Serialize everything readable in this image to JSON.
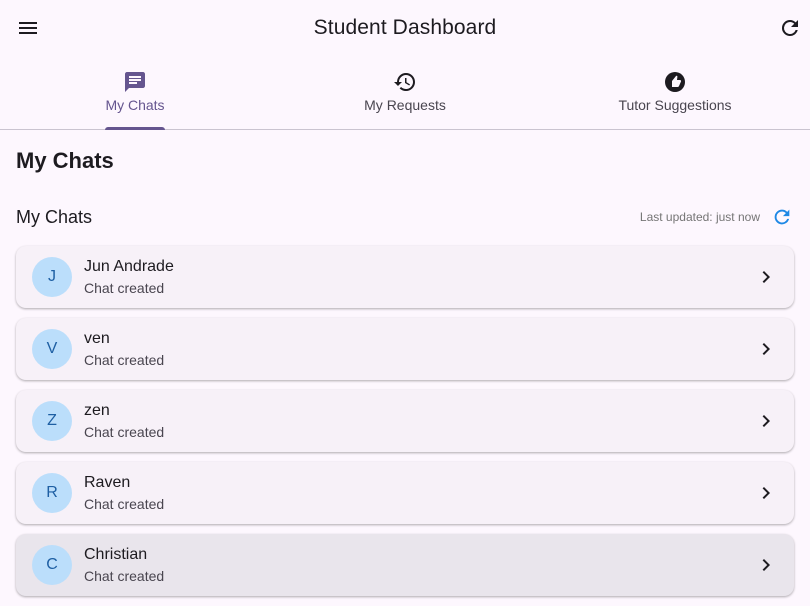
{
  "appbar": {
    "title": "Student Dashboard",
    "menu_icon": "menu-icon",
    "refresh_icon": "refresh-icon"
  },
  "tabs": [
    {
      "label": "My Chats",
      "icon": "chat-icon",
      "active": true
    },
    {
      "label": "My Requests",
      "icon": "history-icon",
      "active": false
    },
    {
      "label": "Tutor Suggestions",
      "icon": "suggestion-icon",
      "active": false
    }
  ],
  "page": {
    "title": "My Chats"
  },
  "section": {
    "title": "My Chats",
    "last_updated": "Last updated: just now",
    "refresh_icon": "refresh-icon"
  },
  "chats": [
    {
      "initial": "J",
      "name": "Jun Andrade",
      "status": "Chat created"
    },
    {
      "initial": "V",
      "name": "ven",
      "status": "Chat created"
    },
    {
      "initial": "Z",
      "name": "zen",
      "status": "Chat created"
    },
    {
      "initial": "R",
      "name": "Raven",
      "status": "Chat created"
    },
    {
      "initial": "C",
      "name": "Christian",
      "status": "Chat created"
    }
  ],
  "colors": {
    "accent": "#65558f",
    "avatar_bg": "#bbdefb",
    "avatar_fg": "#1e5fa3",
    "refresh_blue": "#1e88e5",
    "background": "#fdf7fe"
  }
}
